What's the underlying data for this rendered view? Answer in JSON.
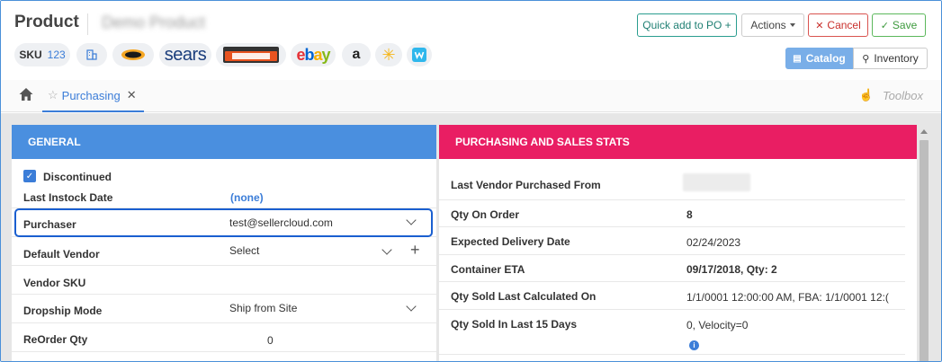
{
  "header": {
    "title": "Product",
    "product_name": "Demo Product",
    "buttons": {
      "quick_add": "Quick add to PO +",
      "actions": "Actions",
      "cancel": "Cancel",
      "save": "Save"
    },
    "sku": {
      "label": "SKU",
      "value": "123"
    },
    "channels": [
      "building-icon",
      "newegg",
      "sears",
      "overstock-sale",
      "ebay",
      "amazon",
      "walmart",
      "wish"
    ],
    "channel_text": {
      "sears": "sears",
      "ebay_e": "e",
      "ebay_b": "b",
      "ebay_a": "a",
      "ebay_y": "y",
      "amazon": "a"
    },
    "view_toggle": {
      "catalog": "Catalog",
      "inventory": "Inventory"
    }
  },
  "tabs": {
    "active": "Purchasing",
    "toolbox": "Toolbox"
  },
  "general": {
    "heading": "GENERAL",
    "discontinued_label": "Discontinued",
    "discontinued_checked": true,
    "fields": [
      {
        "label": "Last Instock Date",
        "value": "(none)"
      },
      {
        "label": "Purchaser",
        "value": "test@sellercloud.com"
      },
      {
        "label": "Default Vendor",
        "value": "Select"
      },
      {
        "label": "Vendor SKU",
        "value": ""
      },
      {
        "label": "Dropship Mode",
        "value": "Ship from Site"
      },
      {
        "label": "ReOrder Qty",
        "value": "0"
      }
    ]
  },
  "stats": {
    "heading": "PURCHASING AND SALES STATS",
    "fields": [
      {
        "label": "Last Vendor Purchased From",
        "value": ""
      },
      {
        "label": "Qty On Order",
        "value": "8"
      },
      {
        "label": "Expected Delivery Date",
        "value": "02/24/2023"
      },
      {
        "label": "Container ETA",
        "value": "09/17/2018, Qty: 2"
      },
      {
        "label": "Qty Sold Last Calculated On",
        "value": "1/1/0001 12:00:00 AM, FBA: 1/1/0001 12:("
      },
      {
        "label": "Qty Sold In Last 15 Days",
        "value": "0, Velocity=0"
      }
    ]
  },
  "colors": {
    "general_header": "#4a8fdf",
    "stats_header": "#e91e63",
    "link": "#3b7dd8"
  }
}
